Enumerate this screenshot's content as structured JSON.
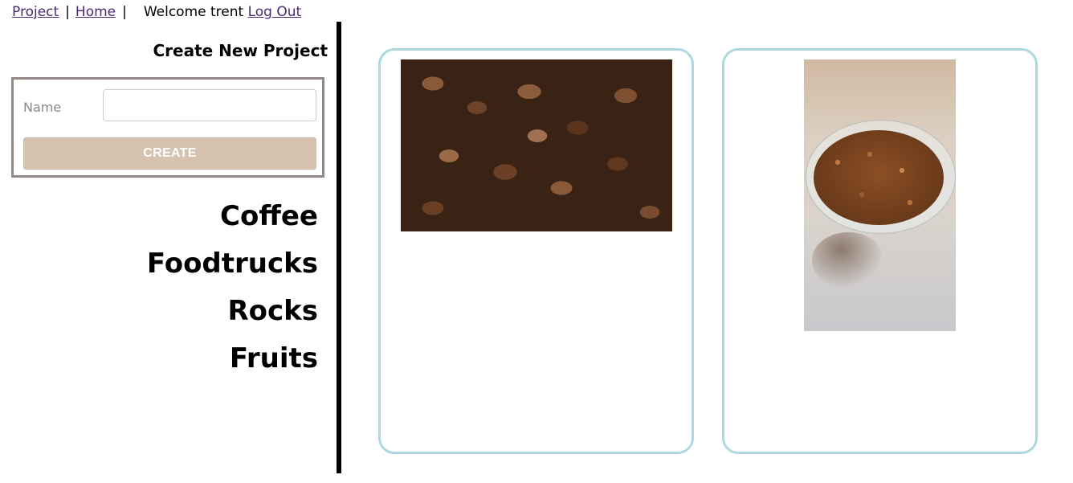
{
  "nav": {
    "project_link": "Project",
    "sep1": "|",
    "home_link": "Home",
    "sep2": "|",
    "welcome_text": "Welcome trent",
    "logout_link": "Log Out"
  },
  "create_form": {
    "title": "Create New Project",
    "name_label": "Name",
    "name_value": "",
    "name_placeholder": "",
    "submit_label": "CREATE"
  },
  "projects": [
    {
      "label": "Coffee"
    },
    {
      "label": "Foodtrucks"
    },
    {
      "label": "Rocks"
    },
    {
      "label": "Fruits"
    }
  ],
  "cards": [
    {
      "image": "coffee-beans-photo"
    },
    {
      "image": "coffee-beans-bowl-photo"
    }
  ],
  "colors": {
    "link": "#4b2a73",
    "form_border": "#918985",
    "button_bg": "#d5c3af",
    "card_border": "#add8e0",
    "divider": "#000000"
  }
}
